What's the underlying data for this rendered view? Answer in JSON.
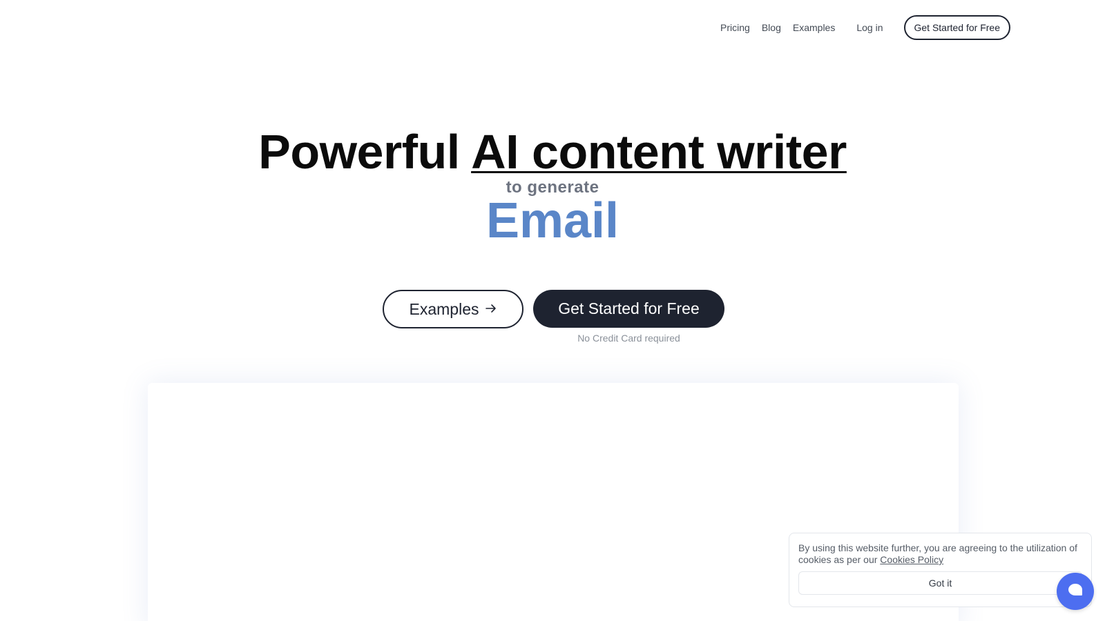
{
  "nav": {
    "links": [
      "Pricing",
      "Blog",
      "Examples"
    ],
    "login": "Log in",
    "cta": "Get Started for Free"
  },
  "hero": {
    "title_plain": "Powerful ",
    "title_underlined": "AI content writer",
    "subtitle": "to generate",
    "word": "Email",
    "examples_button": "Examples",
    "start_button": "Get Started for Free",
    "note": "No Credit Card required"
  },
  "cookie": {
    "text": "By using this website further, you are agreeing to the utilization of cookies as per our ",
    "link": "Cookies Policy",
    "button": "Got it"
  },
  "colors": {
    "accent_word": "#5a86c8",
    "dark_button": "#1e2330",
    "chat_bubble": "#4d6ef0"
  },
  "icons": {
    "examples_arrow": "arrow-right-icon",
    "chat": "chat-icon"
  }
}
